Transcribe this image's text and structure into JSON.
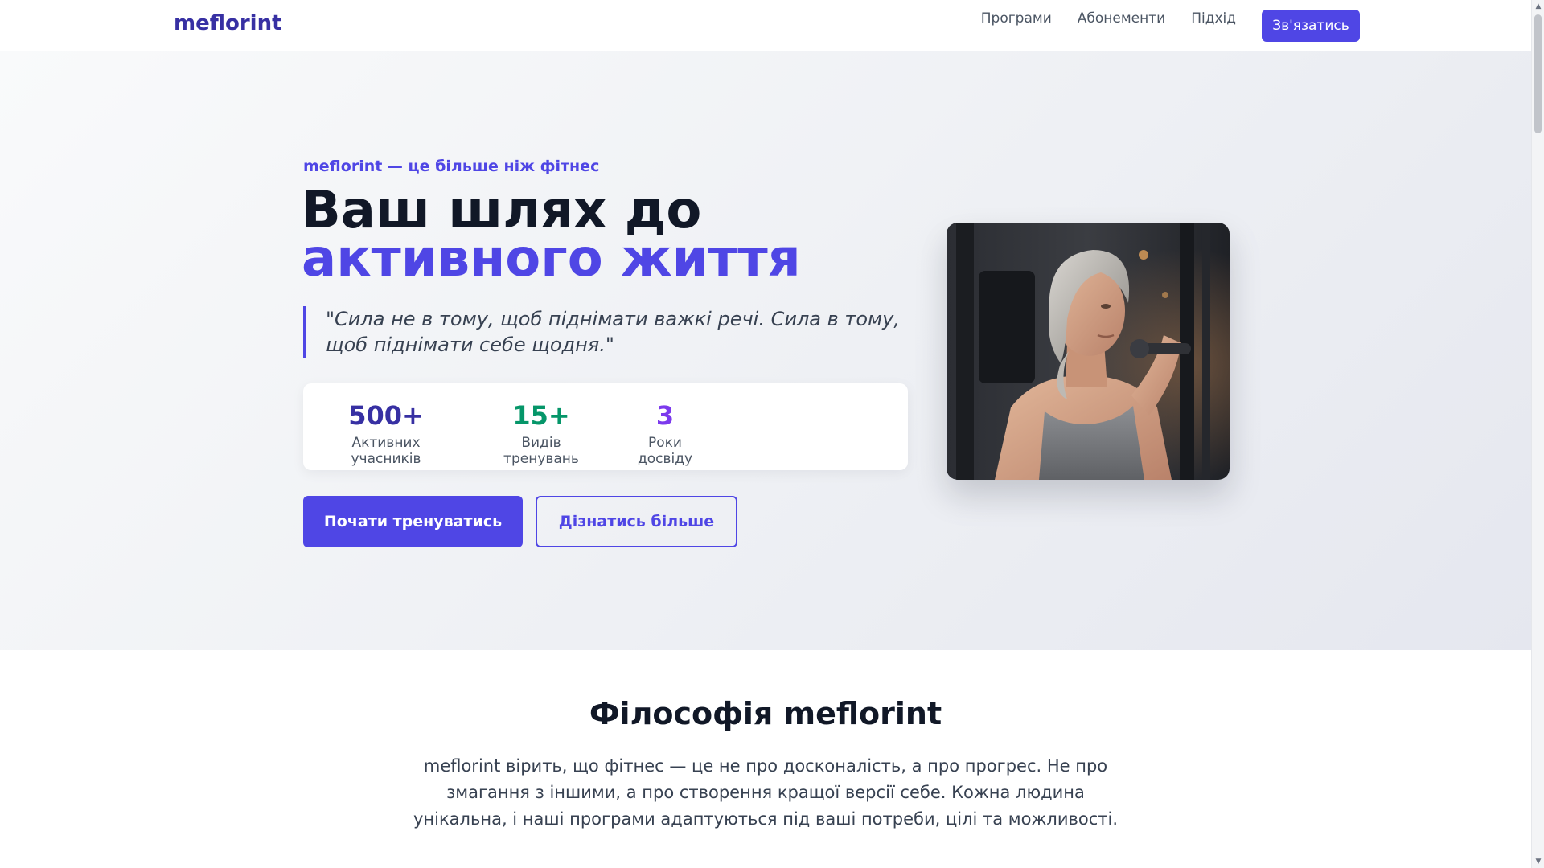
{
  "header": {
    "logo": "meflorint",
    "nav": [
      {
        "label": "Програми"
      },
      {
        "label": "Абонементи"
      },
      {
        "label": "Підхід"
      }
    ],
    "cta": "Зв'язатись"
  },
  "hero": {
    "tagline": "meflorint — це більше ніж фітнес",
    "title_line1": "Ваш шлях до",
    "title_line2": "активного життя",
    "quote": "\"Сила не в тому, щоб піднімати важкі речі. Сила в тому, щоб піднімати себе щодня.\"",
    "stats": [
      {
        "value": "500+",
        "label": "Активних учасників",
        "color": "#3730a3"
      },
      {
        "value": "15+",
        "label": "Видів тренувань",
        "color": "#059669"
      },
      {
        "value": "3",
        "label": "Роки досвіду",
        "color": "#7c3aed"
      }
    ],
    "primary_button": "Почати тренуватись",
    "secondary_button": "Дізнатись більше"
  },
  "philosophy": {
    "title": "Філософія meflorint",
    "text": "meflorint вірить, що фітнес — це не про досконалість, а про прогрес. Не про змагання з іншими, а про створення кращої версії себе. Кожна людина унікальна, і наші програми адаптуються під ваші потреби, цілі та можливості."
  },
  "colors": {
    "accent": "#4f46e5",
    "logo": "#3730a3"
  }
}
